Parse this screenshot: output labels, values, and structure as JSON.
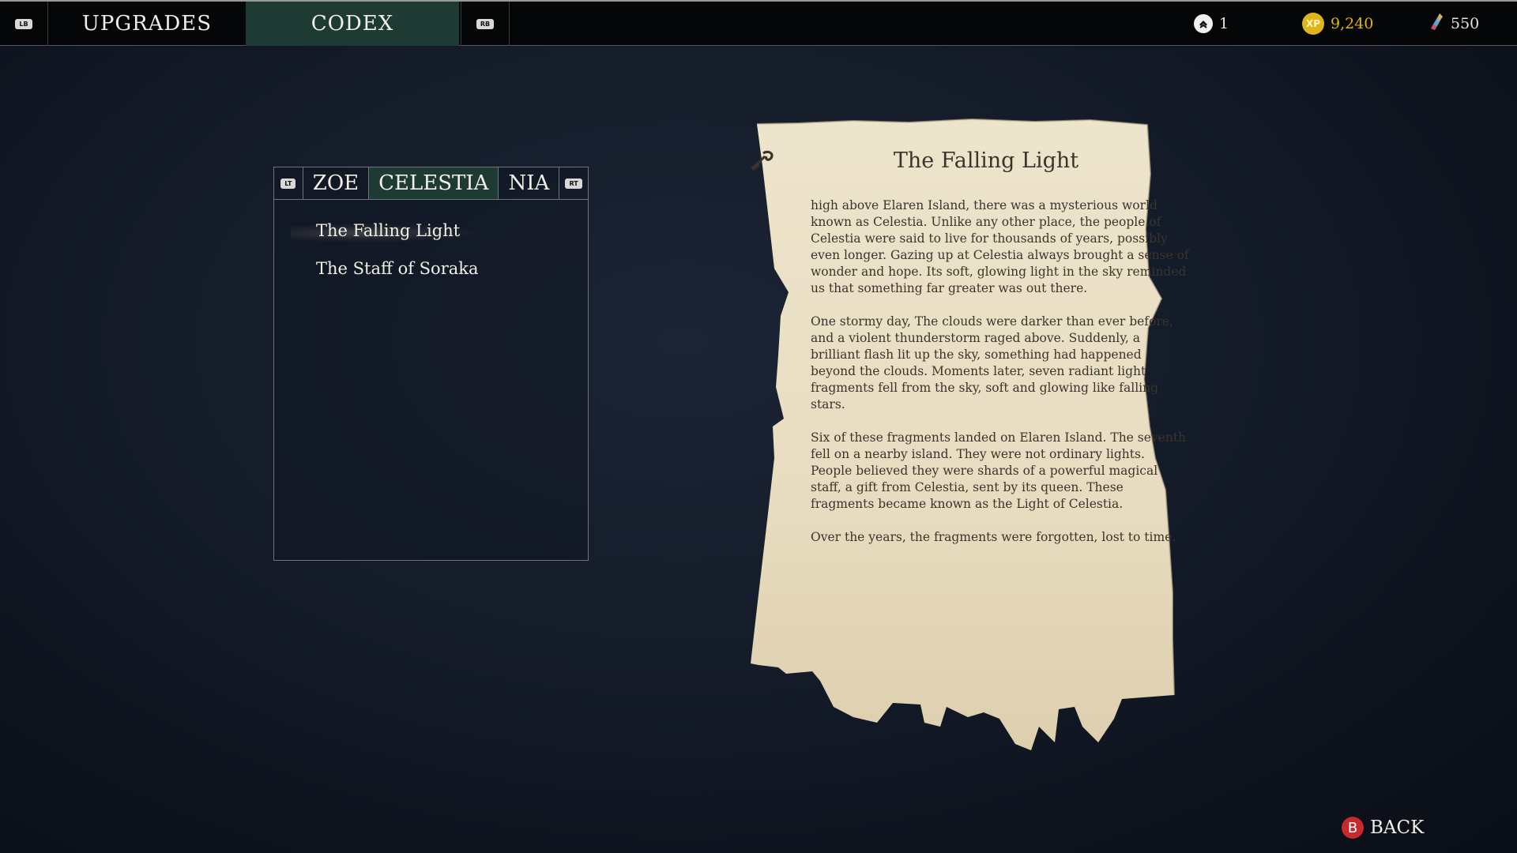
{
  "topbar": {
    "left_bumper": "LB",
    "right_bumper": "RB",
    "tabs": [
      {
        "label": "UPGRADES",
        "active": false
      },
      {
        "label": "CODEX",
        "active": true
      }
    ],
    "rank": {
      "icon": "rank-chevron-icon",
      "value": "1"
    },
    "xp": {
      "icon_text": "XP",
      "value": "9,240",
      "color": "#e0b51c"
    },
    "crystals": {
      "icon": "crystal-shard-icon",
      "value": "550"
    }
  },
  "codex": {
    "left_trigger": "LT",
    "right_trigger": "RT",
    "tabs": [
      {
        "label": "ZOE",
        "active": false
      },
      {
        "label": "CELESTIA",
        "active": true
      },
      {
        "label": "NIA",
        "active": false
      }
    ],
    "entries": [
      {
        "label": "The Falling Light",
        "selected": true
      },
      {
        "label": "The Staff of Soraka",
        "selected": false
      }
    ]
  },
  "page": {
    "title": "The Falling Light",
    "paragraphs": [
      "high above Elaren Island, there was a mysterious world known as Celestia. Unlike any other place, the people of Celestia were said to live for thousands of years, possibly even longer. Gazing up at Celestia always brought a sense of wonder and hope. Its soft, glowing light in the sky reminded us that something far greater was out there.",
      "One stormy day, The clouds were darker than ever before, and a violent thunderstorm raged above. Suddenly, a brilliant flash lit up the sky, something had happened beyond the clouds. Moments later, seven radiant light fragments fell from the sky, soft and glowing like falling stars.",
      "Six of these fragments landed on Elaren Island. The seventh fell on a nearby island. They were not ordinary lights. People believed they were shards of a powerful magical staff, a gift from Celestia, sent by its queen. These fragments became known as the Light of Celestia.",
      "Over the years, the fragments were forgotten, lost to time."
    ]
  },
  "footer": {
    "back_button_glyph": "B",
    "back_label": "BACK",
    "back_color": "#c42a2e"
  },
  "colors": {
    "active_tab": "#1d3a33",
    "parchment": "#e9dec4",
    "ink": "#3b342b"
  }
}
